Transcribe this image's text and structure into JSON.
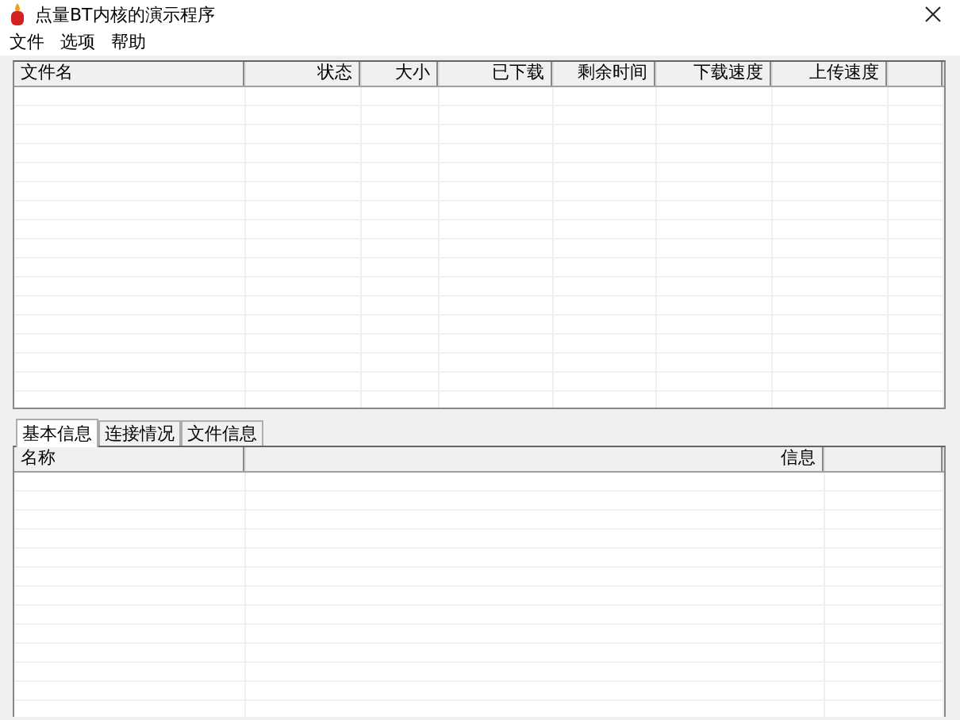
{
  "window": {
    "title": "点量BT内核的演示程序"
  },
  "menu": [
    "文件",
    "选项",
    "帮助"
  ],
  "file_table": {
    "columns": [
      "文件名",
      "状态",
      "大小",
      "已下载",
      "剩余时间",
      "下载速度",
      "上传速度"
    ]
  },
  "tabs": [
    {
      "label": "基本信息",
      "selected": true
    },
    {
      "label": "连接情况",
      "selected": false
    },
    {
      "label": "文件信息",
      "selected": false
    }
  ],
  "info_table": {
    "columns": [
      "名称",
      "信息"
    ]
  }
}
